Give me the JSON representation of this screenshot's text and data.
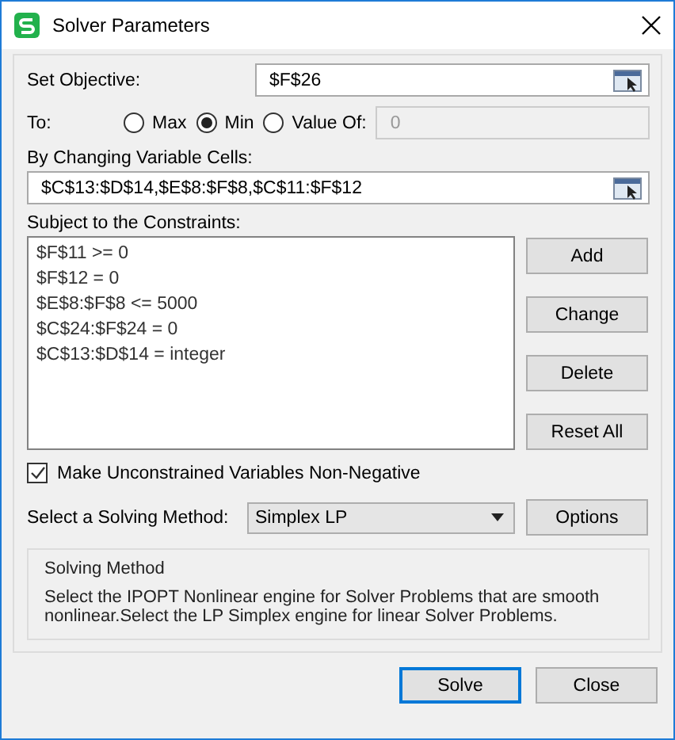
{
  "window": {
    "title": "Solver Parameters"
  },
  "objective": {
    "label": "Set Objective:",
    "value": "$F$26"
  },
  "to": {
    "label": "To:",
    "options": [
      {
        "label": "Max",
        "selected": false
      },
      {
        "label": "Min",
        "selected": true
      },
      {
        "label": "Value Of:",
        "selected": false
      }
    ],
    "value_of": {
      "value": "0",
      "disabled": true
    }
  },
  "changing": {
    "label": "By Changing Variable Cells:",
    "value": "$C$13:$D$14,$E$8:$F$8,$C$11:$F$12"
  },
  "constraints": {
    "label": "Subject to the Constraints:",
    "items": [
      "$F$11 >= 0",
      "$F$12 = 0",
      "$E$8:$F$8 <= 5000",
      "$C$24:$F$24 = 0",
      "$C$13:$D$14 = integer"
    ],
    "buttons": [
      "Add",
      "Change",
      "Delete",
      "Reset All"
    ]
  },
  "nonnegative": {
    "label": "Make Unconstrained Variables Non-Negative",
    "checked": true
  },
  "method": {
    "label": "Select a Solving Method:",
    "value": "Simplex LP",
    "button": "Options"
  },
  "info": {
    "title": "Solving Method",
    "text": "Select the IPOPT Nonlinear engine for Solver Problems that are smooth nonlinear.Select the LP Simplex engine for linear Solver Problems."
  },
  "buttons": [
    {
      "label": "Solve",
      "default": true
    },
    {
      "label": "Close",
      "default": false
    }
  ]
}
